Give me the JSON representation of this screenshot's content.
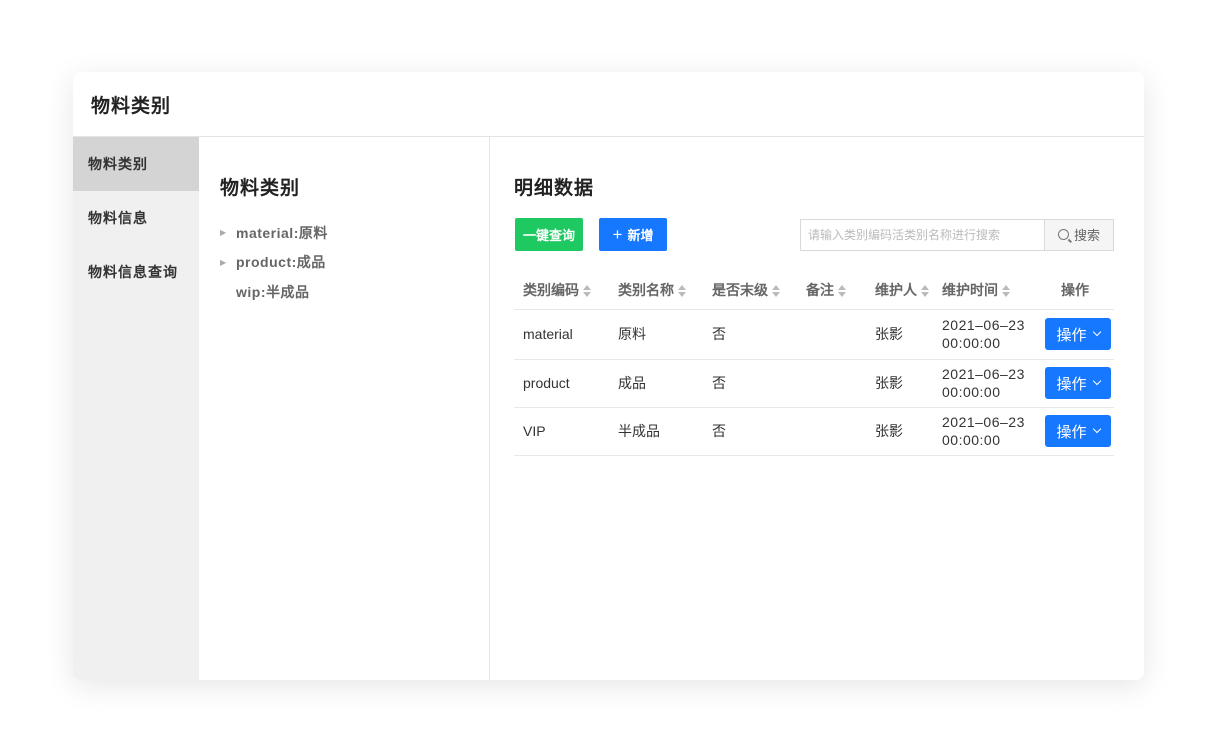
{
  "window": {
    "title": "物料类别"
  },
  "sidebar": {
    "items": [
      {
        "label": "物料类别",
        "active": true
      },
      {
        "label": "物料信息",
        "active": false
      },
      {
        "label": "物料信息查询",
        "active": false
      }
    ]
  },
  "tree": {
    "title": "物料类别",
    "nodes": [
      {
        "label": "material:原料",
        "expandable": true
      },
      {
        "label": "product:成品",
        "expandable": true
      },
      {
        "label": "wip:半成品",
        "expandable": false
      }
    ]
  },
  "detail": {
    "title": "明细数据",
    "toolbar": {
      "query_label": "一键查询",
      "add_label": "新增",
      "search_placeholder": "请输入类别编码活类别名称进行搜索",
      "search_value": "",
      "search_button": "搜索"
    },
    "table": {
      "columns": [
        "类别编码",
        "类别名称",
        "是否末级",
        "备注",
        "维护人",
        "维护时间",
        "操作"
      ],
      "rows": [
        {
          "code": "material",
          "name": "原料",
          "is_leaf": "否",
          "remark": "",
          "maintainer": "张影",
          "date": "2021–06–23",
          "time": "00:00:00",
          "action": "操作"
        },
        {
          "code": "product",
          "name": "成品",
          "is_leaf": "否",
          "remark": "",
          "maintainer": "张影",
          "date": "2021–06–23",
          "time": "00:00:00",
          "action": "操作"
        },
        {
          "code": "VIP",
          "name": "半成品",
          "is_leaf": "否",
          "remark": "",
          "maintainer": "张影",
          "date": "2021–06–23",
          "time": "00:00:00",
          "action": "操作"
        }
      ]
    }
  },
  "colors": {
    "primary": "#1677ff",
    "success": "#1ec961",
    "sidebar_bg": "#f0f0f0",
    "sidebar_active": "#d4d4d4"
  },
  "icons": {
    "search": "search-icon",
    "plus": "plus-icon",
    "dropdown": "chevron-down-icon",
    "tree_caret": "caret-right-icon",
    "sort": "sort-icon"
  }
}
